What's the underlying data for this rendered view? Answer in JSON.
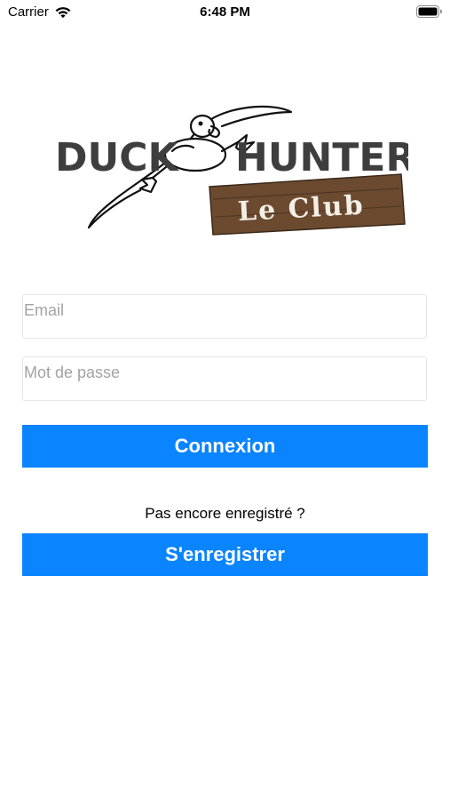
{
  "status_bar": {
    "carrier": "Carrier",
    "time": "6:48 PM",
    "icons": [
      "wifi-icon",
      "battery-icon"
    ]
  },
  "logo": {
    "word_left": "DUCK",
    "word_right": "HUNTER",
    "plank_text": "Le Club",
    "colors": {
      "letters": "#3e3e3e",
      "plank": "#6b4a30",
      "plank_text": "#f4efe6"
    }
  },
  "login_form": {
    "email": {
      "placeholder": "Email",
      "value": ""
    },
    "password": {
      "placeholder": "Mot de passe",
      "value": ""
    },
    "login_label": "Connexion",
    "register_prompt": "Pas encore enregistré ?",
    "register_label": "S'enregistrer"
  },
  "colors": {
    "accent": "#0a84ff",
    "background": "#ffffff",
    "placeholder": "#a3a3a3",
    "field_border": "#e6e6e6"
  }
}
